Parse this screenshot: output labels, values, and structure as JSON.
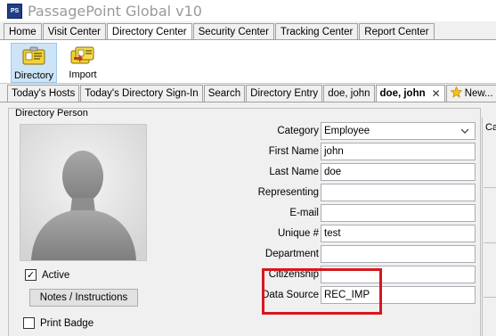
{
  "window": {
    "title": "PassagePoint Global v10",
    "icon_text": "PS"
  },
  "main_tabs": [
    {
      "label": "Home"
    },
    {
      "label": "Visit Center"
    },
    {
      "label": "Directory Center",
      "active": true
    },
    {
      "label": "Security Center"
    },
    {
      "label": "Tracking Center"
    },
    {
      "label": "Report Center"
    }
  ],
  "ribbon": {
    "directory_label": "Directory",
    "import_label": "Import"
  },
  "sub_tabs": [
    {
      "label": "Today's Hosts"
    },
    {
      "label": "Today's Directory Sign-In"
    },
    {
      "label": "Search"
    },
    {
      "label": "Directory Entry"
    },
    {
      "label": "doe, john"
    },
    {
      "label": "doe, john",
      "active": true,
      "closable": true
    },
    {
      "label": "New...",
      "icon": "star-icon"
    }
  ],
  "close_glyph": "✕",
  "panel": {
    "title": "Directory Person",
    "right_label": "Ca"
  },
  "checkbox_active": {
    "label": "Active",
    "checked": true,
    "mark": "✓"
  },
  "notes_button": "Notes / Instructions",
  "checkbox_print": {
    "label": "Print Badge",
    "checked": false
  },
  "form": {
    "category": {
      "label": "Category",
      "value": "Employee"
    },
    "first_name": {
      "label": "First Name",
      "value": "john"
    },
    "last_name": {
      "label": "Last Name",
      "value": "doe"
    },
    "representing": {
      "label": "Representing",
      "value": ""
    },
    "email": {
      "label": "E-mail",
      "value": ""
    },
    "unique": {
      "label": "Unique #",
      "value": "test"
    },
    "department": {
      "label": "Department",
      "value": ""
    },
    "citizenship": {
      "label": "Citizenship",
      "value": ""
    },
    "data_source": {
      "label": "Data Source",
      "value": "REC_IMP"
    }
  },
  "colors": {
    "highlight": "#d9161f",
    "selected_ribbon": "#cde4f7"
  }
}
